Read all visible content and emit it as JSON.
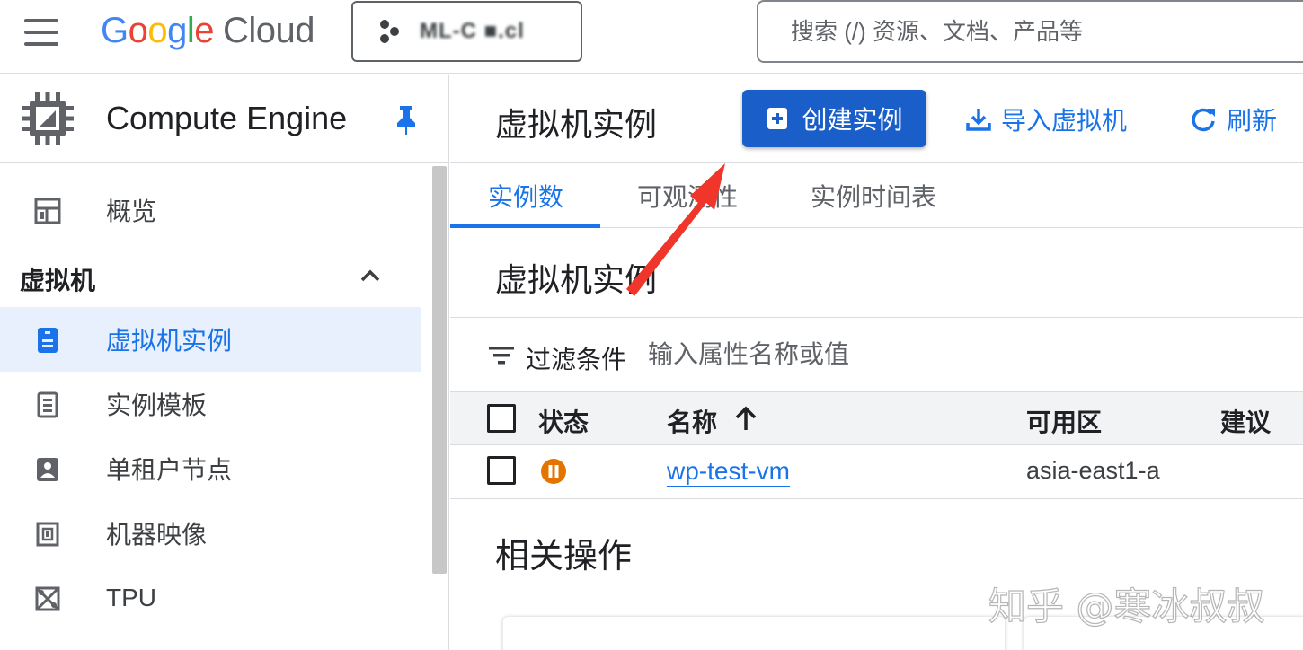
{
  "topbar": {
    "logo": {
      "letters": [
        "G",
        "o",
        "o",
        "g",
        "l",
        "e"
      ],
      "letter_colors": [
        "#4285F4",
        "#EA4335",
        "#FBBC05",
        "#4285F4",
        "#34A853",
        "#EA4335"
      ],
      "cloud": "Cloud"
    },
    "project_name": "ML-C ■.cl",
    "search_placeholder": "搜索 (/) 资源、文档、产品等"
  },
  "sidebar": {
    "product_title": "Compute Engine",
    "items": [
      {
        "label": "概览",
        "icon": "dashboard-icon"
      },
      {
        "label": "虚拟机实例",
        "icon": "vm-instance-icon",
        "active": true
      },
      {
        "label": "实例模板",
        "icon": "instance-template-icon"
      },
      {
        "label": "单租户节点",
        "icon": "sole-tenant-icon"
      },
      {
        "label": "机器映像",
        "icon": "machine-image-icon"
      },
      {
        "label": "TPU",
        "icon": "tpu-icon"
      }
    ],
    "section": {
      "label": "虚拟机",
      "expanded": true
    }
  },
  "main": {
    "page_title": "虚拟机实例",
    "actions": {
      "create": "创建实例",
      "import": "导入虚拟机",
      "refresh": "刷新"
    },
    "tabs": [
      {
        "label": "实例数",
        "active": true
      },
      {
        "label": "可观测性"
      },
      {
        "label": "实例时间表"
      }
    ],
    "section_title": "虚拟机实例",
    "filter": {
      "label": "过滤条件",
      "placeholder": "输入属性名称或值"
    },
    "table": {
      "columns": [
        "状态",
        "名称",
        "可用区",
        "建议"
      ],
      "rows": [
        {
          "status": "paused",
          "name": "wp-test-vm",
          "zone": "asia-east1-a",
          "recommendation": ""
        }
      ]
    },
    "related_title": "相关操作"
  },
  "colors": {
    "primary": "#1a73e8",
    "create_button": "#1a5fc9",
    "status_paused": "#e37400",
    "annotation_arrow": "#f0352a"
  },
  "watermark": "知乎 @寒冰叔叔"
}
